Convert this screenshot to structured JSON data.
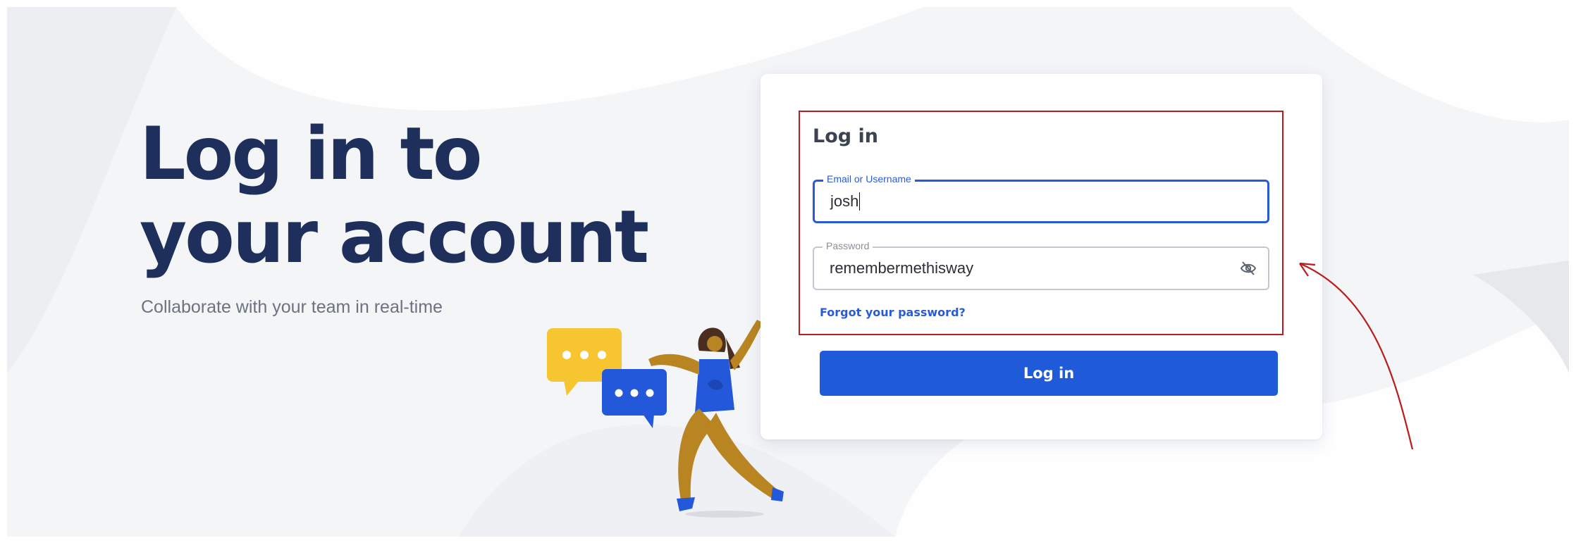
{
  "hero": {
    "title_line1": "Log in to",
    "title_line2": "your account",
    "subtitle": "Collaborate with your team in real-time"
  },
  "login_form": {
    "heading": "Log in",
    "email": {
      "label": "Email or Username",
      "value": "josh"
    },
    "password": {
      "label": "Password",
      "value": "remembermethisway",
      "toggle_icon": "eye-slash-icon"
    },
    "forgot_link": "Forgot your password?",
    "submit_label": "Log in"
  },
  "illustration": {
    "icons": [
      "chat-bubble-yellow-icon",
      "chat-bubble-blue-icon",
      "dancing-person-illustration"
    ]
  },
  "annotation": {
    "icon": "red-arrow-icon"
  },
  "colors": {
    "primary": "#1f5ad9",
    "heading": "#1e2f5b",
    "annotation_red": "#b91c1c",
    "chat_yellow": "#f7c52f",
    "chat_blue": "#2258d9"
  }
}
